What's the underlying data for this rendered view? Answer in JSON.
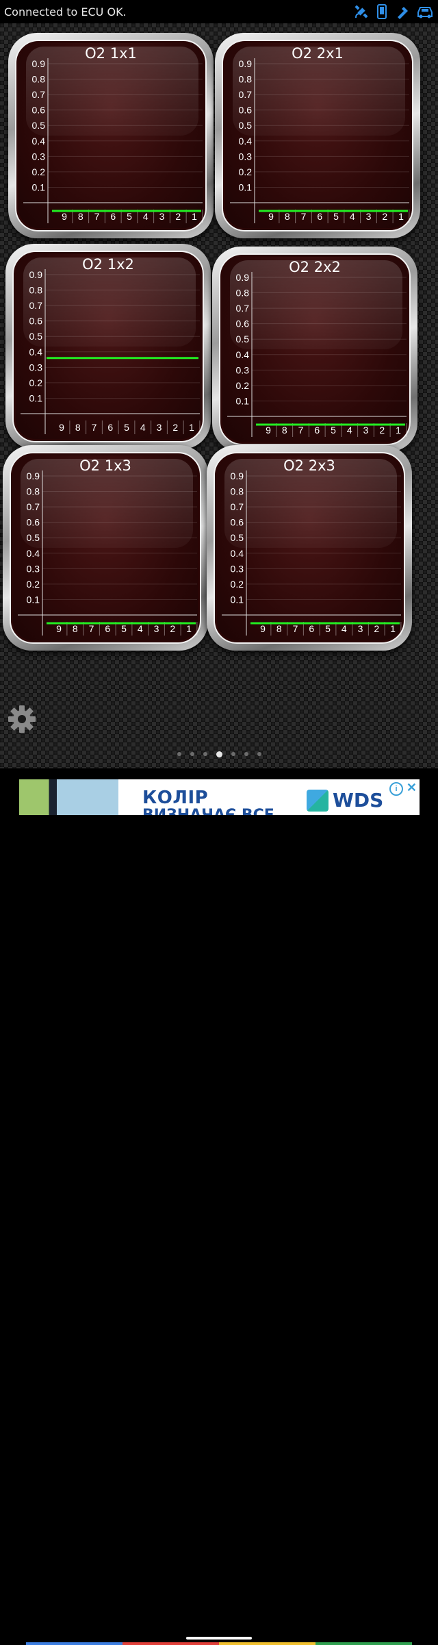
{
  "status": {
    "message": "Connected to ECU OK.",
    "icons": [
      "satellite-icon",
      "phone-icon",
      "bluetooth-icon",
      "car-icon"
    ],
    "icon_color": "#2f8fe8"
  },
  "gauges": [
    {
      "title": "O2 1x1",
      "value": 0.0
    },
    {
      "title": "O2 2x1",
      "value": 0.0
    },
    {
      "title": "O2 1x2",
      "value": 0.4
    },
    {
      "title": "O2 2x2",
      "value": 0.0
    },
    {
      "title": "O2 1x3",
      "value": 0.0
    },
    {
      "title": "O2 2x3",
      "value": 0.0
    }
  ],
  "axis": {
    "y_ticks": [
      "0.9",
      "0.8",
      "0.7",
      "0.6",
      "0.5",
      "0.4",
      "0.3",
      "0.2",
      "0.1"
    ],
    "x_ticks": [
      "9",
      "8",
      "7",
      "6",
      "5",
      "4",
      "3",
      "2",
      "1"
    ],
    "ylim": [
      0,
      1
    ],
    "line_color": "#22ee22"
  },
  "settings_icon": "gear-icon",
  "pager": {
    "count": 7,
    "active": 3
  },
  "ad": {
    "title": "КОЛІР",
    "subtitle": "ВИЗНАЧАЄ ВСЕ",
    "brand": "WDS",
    "info_icon": "info-icon",
    "close_icon": "close-icon"
  },
  "nav": {
    "strip_colors": [
      "#3d7ee0",
      "#e0403a",
      "#f0c030",
      "#30a050"
    ]
  }
}
